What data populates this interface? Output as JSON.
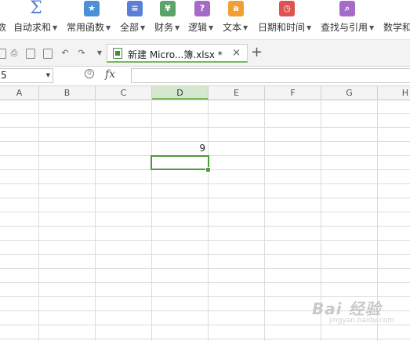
{
  "ribbon": {
    "left_cut": "数",
    "autosum": "自动求和",
    "common": "常用函数",
    "all": "全部",
    "finance": "财务",
    "logic": "逻辑",
    "text": "文本",
    "datetime": "日期和时间",
    "lookup": "查找与引用",
    "math": "数学和",
    "icons": {
      "autosum": "Σ",
      "common": "★",
      "all": "≡",
      "finance": "¥",
      "logic": "?",
      "text": "a",
      "datetime": "◷",
      "lookup": "⌕"
    },
    "icon_colors": {
      "common": "#4a90d9",
      "all": "#5b7fd6",
      "finance": "#5aa469",
      "logic": "#a66bc9",
      "text": "#f0a033",
      "datetime": "#e05252",
      "lookup": "#a66bc9"
    }
  },
  "tabbar": {
    "doc_tab_title": "新建 Micro...簿.xlsx *",
    "close": "×",
    "add": "+"
  },
  "formula_bar": {
    "name_box": "5",
    "fx": "fx",
    "value": ""
  },
  "columns": [
    "A",
    "B",
    "C",
    "D",
    "E",
    "F",
    "G",
    "H"
  ],
  "selected_column": "D",
  "cells": {
    "D_value": "9"
  },
  "watermark": {
    "text": "Bai 经验",
    "sub": "jingyan.baidu.com"
  }
}
